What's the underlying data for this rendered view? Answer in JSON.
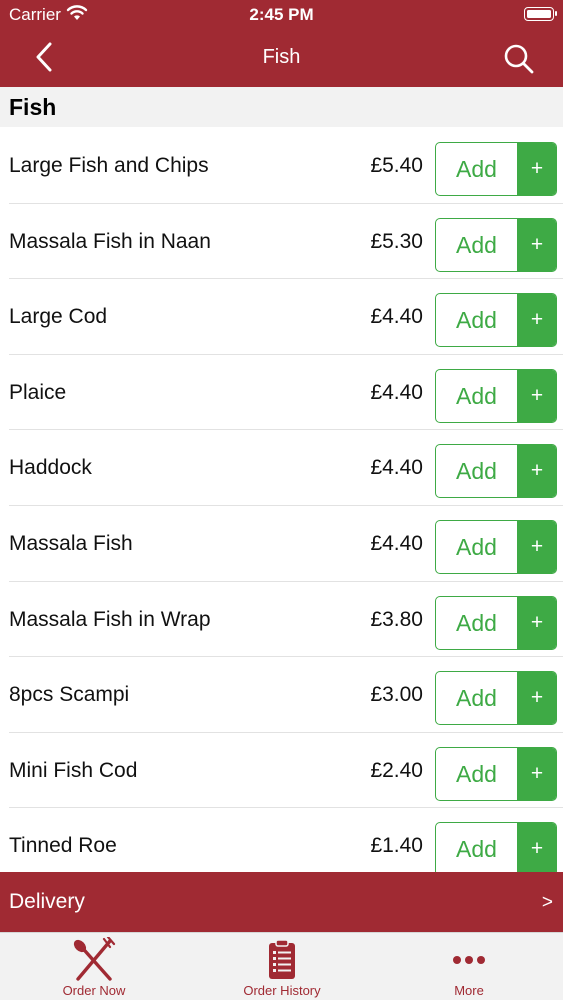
{
  "status_bar": {
    "carrier": "Carrier",
    "time": "2:45 PM"
  },
  "nav": {
    "title": "Fish",
    "back_icon": "chevron-left-icon",
    "search_icon": "search-icon"
  },
  "section": {
    "title": "Fish"
  },
  "items": [
    {
      "name": "Large Fish and Chips",
      "price": "£5.40",
      "add_label": "Add",
      "plus_label": "+"
    },
    {
      "name": "Massala Fish in Naan",
      "price": "£5.30",
      "add_label": "Add",
      "plus_label": "+"
    },
    {
      "name": "Large Cod",
      "price": "£4.40",
      "add_label": "Add",
      "plus_label": "+"
    },
    {
      "name": "Plaice",
      "price": "£4.40",
      "add_label": "Add",
      "plus_label": "+"
    },
    {
      "name": "Haddock",
      "price": "£4.40",
      "add_label": "Add",
      "plus_label": "+"
    },
    {
      "name": "Massala Fish",
      "price": "£4.40",
      "add_label": "Add",
      "plus_label": "+"
    },
    {
      "name": "Massala Fish in Wrap",
      "price": "£3.80",
      "add_label": "Add",
      "plus_label": "+"
    },
    {
      "name": "8pcs Scampi",
      "price": "£3.00",
      "add_label": "Add",
      "plus_label": "+"
    },
    {
      "name": "Mini Fish Cod",
      "price": "£2.40",
      "add_label": "Add",
      "plus_label": "+"
    },
    {
      "name": "Tinned Roe",
      "price": "£1.40",
      "add_label": "Add",
      "plus_label": "+"
    }
  ],
  "delivery": {
    "label": "Delivery",
    "arrow": ">"
  },
  "tabs": [
    {
      "label": "Order Now",
      "icon": "fork-spoon-icon"
    },
    {
      "label": "Order History",
      "icon": "clipboard-icon"
    },
    {
      "label": "More",
      "icon": "more-dots-icon"
    }
  ],
  "colors": {
    "brand": "#a02a33",
    "accent": "#3eaa45",
    "section_bg": "#f2f2f2"
  }
}
